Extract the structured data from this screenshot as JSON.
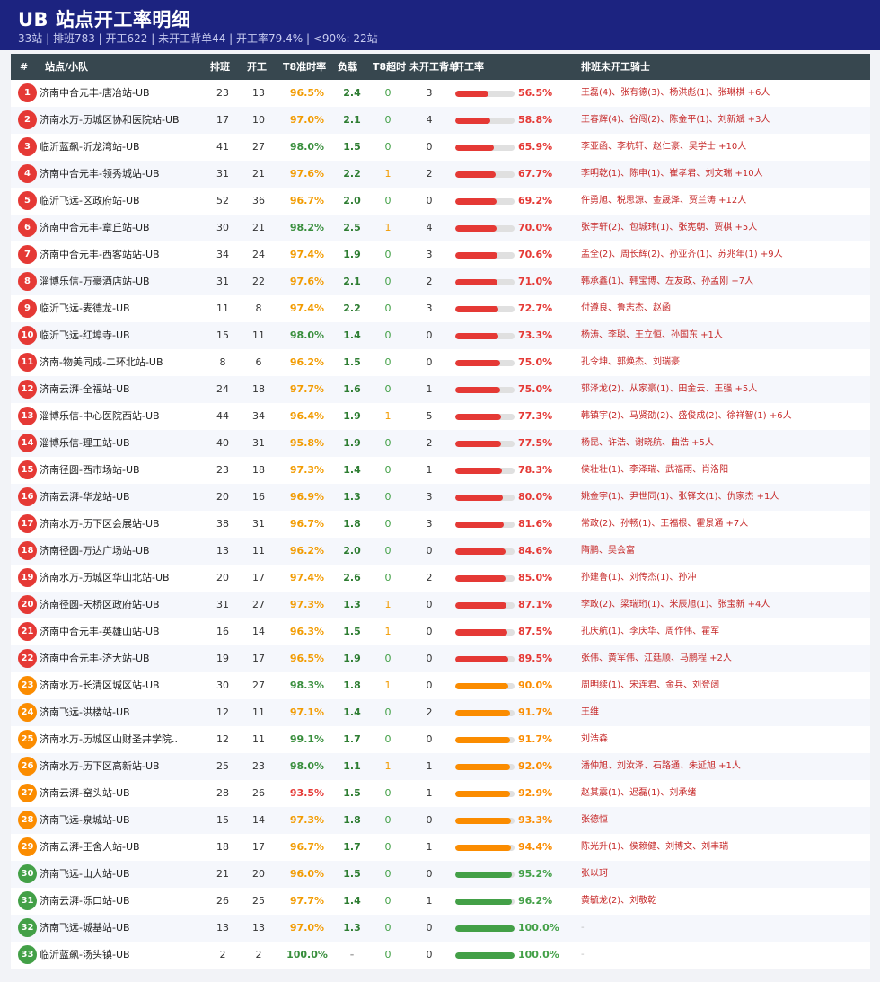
{
  "header": {
    "title": "UB 站点开工率明细",
    "subtitle": "33站 | 排班783 | 开工622 | 未开工背单44 | 开工率79.4% | <90%: 22站"
  },
  "columns": [
    "#",
    "站点/小队",
    "排班",
    "开工",
    "T8准时率",
    "负载",
    "T8超时",
    "未开工背单",
    "开工率",
    "排班未开工骑士"
  ],
  "colors": {
    "red": "#e53935",
    "orange": "#fb8c00",
    "green": "#43a047",
    "t8_orange": "#f29b00",
    "t8_green": "#388e3c",
    "t8_red": "#e53935",
    "load": "#2e7d32",
    "zero": "#43a047",
    "over": "#f29b00"
  },
  "rows": [
    {
      "rank": "1",
      "name": "济南中合元丰-唐冶站-UB",
      "sched": "23",
      "work": "13",
      "t8": "96.5%",
      "load": "2.4",
      "over": "0",
      "unstart": "3",
      "rate": "56.5%",
      "rate_val": 56.5,
      "riders": "王磊(4)、张有德(3)、杨洪彪(1)、张琳棋 +6人"
    },
    {
      "rank": "2",
      "name": "济南水万-历城区协和医院站-UB",
      "sched": "17",
      "work": "10",
      "t8": "97.0%",
      "load": "2.1",
      "over": "0",
      "unstart": "4",
      "rate": "58.8%",
      "rate_val": 58.8,
      "riders": "王春辉(4)、谷闯(2)、陈金平(1)、刘新斌 +3人"
    },
    {
      "rank": "3",
      "name": "临沂蓝飙-沂龙湾站-UB",
      "sched": "41",
      "work": "27",
      "t8": "98.0%",
      "load": "1.5",
      "over": "0",
      "unstart": "0",
      "rate": "65.9%",
      "rate_val": 65.9,
      "riders": "李亚函、李杭轩、赵仁豪、吴学士 +10人"
    },
    {
      "rank": "4",
      "name": "济南中合元丰-领秀城站-UB",
      "sched": "31",
      "work": "21",
      "t8": "97.6%",
      "load": "2.2",
      "over": "1",
      "unstart": "2",
      "rate": "67.7%",
      "rate_val": 67.7,
      "riders": "李明乾(1)、陈申(1)、崔孝君、刘文瑞 +10人"
    },
    {
      "rank": "5",
      "name": "临沂飞远-区政府站-UB",
      "sched": "52",
      "work": "36",
      "t8": "96.7%",
      "load": "2.0",
      "over": "0",
      "unstart": "0",
      "rate": "69.2%",
      "rate_val": 69.2,
      "riders": "仵勇旭、税思源、金晟泽、贾兰涛 +12人"
    },
    {
      "rank": "6",
      "name": "济南中合元丰-章丘站-UB",
      "sched": "30",
      "work": "21",
      "t8": "98.2%",
      "load": "2.5",
      "over": "1",
      "unstart": "4",
      "rate": "70.0%",
      "rate_val": 70.0,
      "riders": "张宇轩(2)、包城玮(1)、张宪朝、贾棋 +5人"
    },
    {
      "rank": "7",
      "name": "济南中合元丰-西客站站-UB",
      "sched": "34",
      "work": "24",
      "t8": "97.4%",
      "load": "1.9",
      "over": "0",
      "unstart": "3",
      "rate": "70.6%",
      "rate_val": 70.6,
      "riders": "孟全(2)、周长辉(2)、孙亚齐(1)、苏兆年(1) +9人"
    },
    {
      "rank": "8",
      "name": "淄博乐信-万豪酒店站-UB",
      "sched": "31",
      "work": "22",
      "t8": "97.6%",
      "load": "2.1",
      "over": "0",
      "unstart": "2",
      "rate": "71.0%",
      "rate_val": 71.0,
      "riders": "韩承鑫(1)、韩宝博、左友政、孙孟刚 +7人"
    },
    {
      "rank": "9",
      "name": "临沂飞远-麦德龙-UB",
      "sched": "11",
      "work": "8",
      "t8": "97.4%",
      "load": "2.2",
      "over": "0",
      "unstart": "3",
      "rate": "72.7%",
      "rate_val": 72.7,
      "riders": "付遵良、鲁志杰、赵函"
    },
    {
      "rank": "10",
      "name": "临沂飞远-红埠寺-UB",
      "sched": "15",
      "work": "11",
      "t8": "98.0%",
      "load": "1.4",
      "over": "0",
      "unstart": "0",
      "rate": "73.3%",
      "rate_val": 73.3,
      "riders": "杨涛、李聪、王立恒、孙国东 +1人"
    },
    {
      "rank": "11",
      "name": "济南-物美同成-二环北站-UB",
      "sched": "8",
      "work": "6",
      "t8": "96.2%",
      "load": "1.5",
      "over": "0",
      "unstart": "0",
      "rate": "75.0%",
      "rate_val": 75.0,
      "riders": "孔令坤、郭焕杰、刘瑞豪"
    },
    {
      "rank": "12",
      "name": "济南云湃-全福站-UB",
      "sched": "24",
      "work": "18",
      "t8": "97.7%",
      "load": "1.6",
      "over": "0",
      "unstart": "1",
      "rate": "75.0%",
      "rate_val": 75.0,
      "riders": "郭泽龙(2)、从家豪(1)、田金云、王强 +5人"
    },
    {
      "rank": "13",
      "name": "淄博乐信-中心医院西站-UB",
      "sched": "44",
      "work": "34",
      "t8": "96.4%",
      "load": "1.9",
      "over": "1",
      "unstart": "5",
      "rate": "77.3%",
      "rate_val": 77.3,
      "riders": "韩镇宇(2)、马贤劭(2)、盛俊成(2)、徐祥智(1) +6人"
    },
    {
      "rank": "14",
      "name": "淄博乐信-理工站-UB",
      "sched": "40",
      "work": "31",
      "t8": "95.8%",
      "load": "1.9",
      "over": "0",
      "unstart": "2",
      "rate": "77.5%",
      "rate_val": 77.5,
      "riders": "杨昆、许浩、谢晓航、曲浩 +5人"
    },
    {
      "rank": "15",
      "name": "济南径圆-西市场站-UB",
      "sched": "23",
      "work": "18",
      "t8": "97.3%",
      "load": "1.4",
      "over": "0",
      "unstart": "1",
      "rate": "78.3%",
      "rate_val": 78.3,
      "riders": "侯壮壮(1)、李泽瑞、武福雨、肖洛阳"
    },
    {
      "rank": "16",
      "name": "济南云湃-华龙站-UB",
      "sched": "20",
      "work": "16",
      "t8": "96.9%",
      "load": "1.3",
      "over": "0",
      "unstart": "3",
      "rate": "80.0%",
      "rate_val": 80.0,
      "riders": "姚金宇(1)、尹世同(1)、张铎文(1)、仇家杰 +1人"
    },
    {
      "rank": "17",
      "name": "济南水万-历下区会展站-UB",
      "sched": "38",
      "work": "31",
      "t8": "96.7%",
      "load": "1.8",
      "over": "0",
      "unstart": "3",
      "rate": "81.6%",
      "rate_val": 81.6,
      "riders": "常政(2)、孙畅(1)、王福根、霍景通 +7人"
    },
    {
      "rank": "18",
      "name": "济南径圆-万达广场站-UB",
      "sched": "13",
      "work": "11",
      "t8": "96.2%",
      "load": "2.0",
      "over": "0",
      "unstart": "0",
      "rate": "84.6%",
      "rate_val": 84.6,
      "riders": "隋鹏、吴会富"
    },
    {
      "rank": "19",
      "name": "济南水万-历城区华山北站-UB",
      "sched": "20",
      "work": "17",
      "t8": "97.4%",
      "load": "2.6",
      "over": "0",
      "unstart": "2",
      "rate": "85.0%",
      "rate_val": 85.0,
      "riders": "孙建鲁(1)、刘传杰(1)、孙冲"
    },
    {
      "rank": "20",
      "name": "济南径圆-天桥区政府站-UB",
      "sched": "31",
      "work": "27",
      "t8": "97.3%",
      "load": "1.3",
      "over": "1",
      "unstart": "0",
      "rate": "87.1%",
      "rate_val": 87.1,
      "riders": "李政(2)、梁瑞珩(1)、米辰旭(1)、张宝新 +4人"
    },
    {
      "rank": "21",
      "name": "济南中合元丰-英雄山站-UB",
      "sched": "16",
      "work": "14",
      "t8": "96.3%",
      "load": "1.5",
      "over": "1",
      "unstart": "0",
      "rate": "87.5%",
      "rate_val": 87.5,
      "riders": "孔庆航(1)、李庆华、周作伟、霍军"
    },
    {
      "rank": "22",
      "name": "济南中合元丰-济大站-UB",
      "sched": "19",
      "work": "17",
      "t8": "96.5%",
      "load": "1.9",
      "over": "0",
      "unstart": "0",
      "rate": "89.5%",
      "rate_val": 89.5,
      "riders": "张伟、黄军伟、江廷顺、马鹏程 +2人"
    },
    {
      "rank": "23",
      "name": "济南水万-长清区城区站-UB",
      "sched": "30",
      "work": "27",
      "t8": "98.3%",
      "load": "1.8",
      "over": "1",
      "unstart": "0",
      "rate": "90.0%",
      "rate_val": 90.0,
      "riders": "周明续(1)、宋连君、金兵、刘登阔"
    },
    {
      "rank": "24",
      "name": "济南飞远-洪楼站-UB",
      "sched": "12",
      "work": "11",
      "t8": "97.1%",
      "load": "1.4",
      "over": "0",
      "unstart": "2",
      "rate": "91.7%",
      "rate_val": 91.7,
      "riders": "王维"
    },
    {
      "rank": "25",
      "name": "济南水万-历城区山财圣井学院..",
      "sched": "12",
      "work": "11",
      "t8": "99.1%",
      "load": "1.7",
      "over": "0",
      "unstart": "0",
      "rate": "91.7%",
      "rate_val": 91.7,
      "riders": "刘浩森"
    },
    {
      "rank": "26",
      "name": "济南水万-历下区高新站-UB",
      "sched": "25",
      "work": "23",
      "t8": "98.0%",
      "load": "1.1",
      "over": "1",
      "unstart": "1",
      "rate": "92.0%",
      "rate_val": 92.0,
      "riders": "潘仲旭、刘汝泽、石路通、朱延旭 +1人"
    },
    {
      "rank": "27",
      "name": "济南云湃-窑头站-UB",
      "sched": "28",
      "work": "26",
      "t8": "93.5%",
      "load": "1.5",
      "over": "0",
      "unstart": "1",
      "rate": "92.9%",
      "rate_val": 92.9,
      "riders": "赵其震(1)、迟磊(1)、刘承绪"
    },
    {
      "rank": "28",
      "name": "济南飞远-泉城站-UB",
      "sched": "15",
      "work": "14",
      "t8": "97.3%",
      "load": "1.8",
      "over": "0",
      "unstart": "0",
      "rate": "93.3%",
      "rate_val": 93.3,
      "riders": "张德恒"
    },
    {
      "rank": "29",
      "name": "济南云湃-王舍人站-UB",
      "sched": "18",
      "work": "17",
      "t8": "96.7%",
      "load": "1.7",
      "over": "0",
      "unstart": "1",
      "rate": "94.4%",
      "rate_val": 94.4,
      "riders": "陈光升(1)、侯赖健、刘博文、刘丰瑞"
    },
    {
      "rank": "30",
      "name": "济南飞远-山大站-UB",
      "sched": "21",
      "work": "20",
      "t8": "96.0%",
      "load": "1.5",
      "over": "0",
      "unstart": "0",
      "rate": "95.2%",
      "rate_val": 95.2,
      "riders": "张以珂"
    },
    {
      "rank": "31",
      "name": "济南云湃-泺口站-UB",
      "sched": "26",
      "work": "25",
      "t8": "97.7%",
      "load": "1.4",
      "over": "0",
      "unstart": "1",
      "rate": "96.2%",
      "rate_val": 96.2,
      "riders": "黄毓龙(2)、刘敬乾"
    },
    {
      "rank": "32",
      "name": "济南飞远-城基站-UB",
      "sched": "13",
      "work": "13",
      "t8": "97.0%",
      "load": "1.3",
      "over": "0",
      "unstart": "0",
      "rate": "100.0%",
      "rate_val": 100.0,
      "riders": "-"
    },
    {
      "rank": "33",
      "name": "临沂蓝飙-汤头镇-UB",
      "sched": "2",
      "work": "2",
      "t8": "100.0%",
      "load": "-",
      "over": "0",
      "unstart": "0",
      "rate": "100.0%",
      "rate_val": 100.0,
      "riders": "-"
    }
  ]
}
